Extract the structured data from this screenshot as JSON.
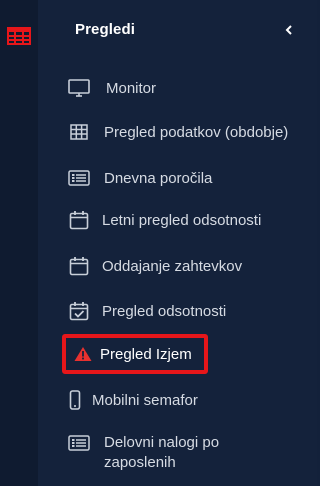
{
  "header": {
    "title": "Pregledi",
    "collapse_icon": "chevron-left-icon"
  },
  "rail": {
    "icon": "table-icon",
    "icon_color": "#e6161a"
  },
  "menu": {
    "items": [
      {
        "label": "Monitor",
        "icon": "monitor-icon"
      },
      {
        "label": "Pregled podatkov (obdobje)",
        "icon": "table-icon"
      },
      {
        "label": "Dnevna poročila",
        "icon": "list-icon"
      },
      {
        "label": "Letni pregled odsotnosti",
        "icon": "calendar-icon"
      },
      {
        "label": "Oddajanje zahtevkov",
        "icon": "calendar-icon"
      },
      {
        "label": "Pregled odsotnosti",
        "icon": "calendar-check-icon"
      },
      {
        "label": "Pregled Izjem",
        "icon": "warning-icon",
        "active": true
      },
      {
        "label": "Mobilni semafor",
        "icon": "mobile-icon"
      },
      {
        "label": "Delovni nalogi po zaposlenih",
        "icon": "list-icon"
      }
    ]
  },
  "colors": {
    "background": "#13213a",
    "text": "#d6dbe3",
    "highlight": "#e6161a",
    "warning": "#e8312f"
  }
}
